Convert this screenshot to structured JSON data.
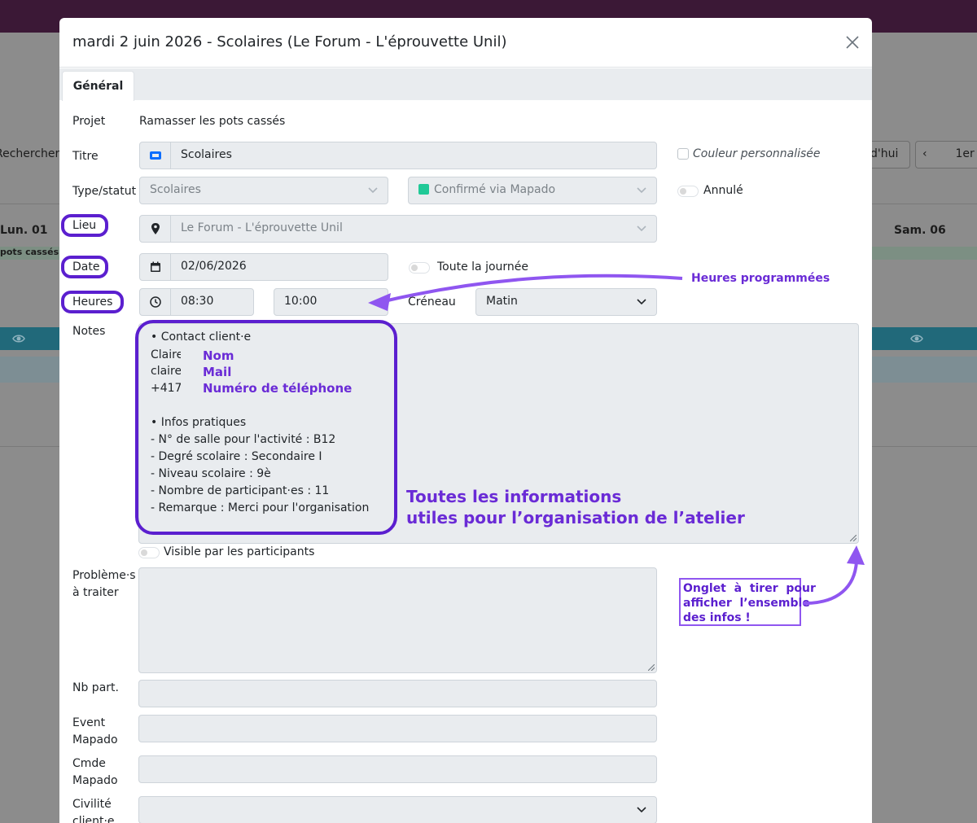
{
  "background": {
    "search_label": "Rechercher",
    "today_label": "d'hui",
    "date_label": "1er",
    "day_left": "Lun. 01",
    "day_right": "Sam. 06",
    "event_label": "pots cassés"
  },
  "modal": {
    "title": "mardi 2 juin 2026 - Scolaires (Le Forum - L'éprouvette Unil)",
    "tab_general": "Général"
  },
  "form": {
    "projet_label": "Projet",
    "projet_value": "Ramasser les pots cassés",
    "titre_label": "Titre",
    "titre_value": "Scolaires",
    "couleur_label": "Couleur personnalisée",
    "type_label": "Type/statut",
    "type_value": "Scolaires",
    "statut_value": "Confirmé via Mapado",
    "statut_color": "#20c997",
    "annule_label": "Annulé",
    "lieu_label": "Lieu",
    "lieu_value": "Le Forum - L'éprouvette Unil",
    "date_label": "Date",
    "date_value": "02/06/2026",
    "toute_journee_label": "Toute la journée",
    "heures_label": "Heures",
    "heure_debut": "08:30",
    "heure_fin": "10:00",
    "creneau_label": "Créneau",
    "creneau_value": "Matin",
    "notes_label": "Notes",
    "notes_lines": [
      "• Contact client·e",
      "Claire",
      "clairel",
      "+4176",
      "• Infos pratiques",
      " - N° de salle pour l'activité : B12",
      " - Degré scolaire : Secondaire I",
      " - Niveau scolaire : 9è",
      " - Nombre de participant·es : 11",
      " - Remarque : Merci pour l'organisation"
    ],
    "visible_label": "Visible par les participants",
    "problemes_label_1": "Problème·s",
    "problemes_label_2": "à traiter",
    "nb_part_label": "Nb part.",
    "event_label_1": "Event",
    "event_label_2": "Mapado",
    "cmde_label_1": "Cmde",
    "cmde_label_2": "Mapado",
    "civilite_label_1": "Civilité",
    "civilite_label_2": "client·e"
  },
  "annotations": {
    "heures_programmees": "Heures programmées",
    "nom": "Nom",
    "mail": "Mail",
    "telephone": "Numéro de téléphone",
    "toutes_infos_1": "Toutes les informations",
    "toutes_infos_2": "utiles pour l’organisation de l’atelier",
    "onglet_1": "Onglet  à  tirer  pour",
    "onglet_2": "afficher  l’ensemble",
    "onglet_3": "des infos !",
    "accent_color": "#5b1fcf"
  }
}
